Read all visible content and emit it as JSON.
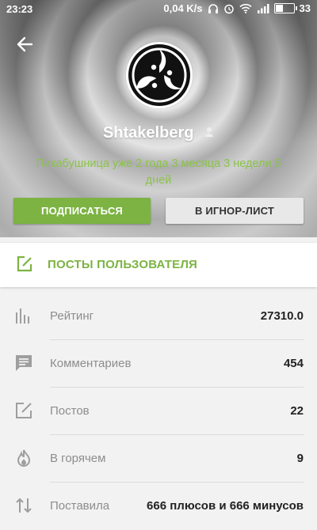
{
  "status_bar": {
    "time": "23:23",
    "speed": "0,04 K/s",
    "battery": "33"
  },
  "profile": {
    "username": "Shtakelberg",
    "tenure": "Пикабушница уже 2 года 3 месяца 3 недели 5 дней",
    "subscribe_label": "ПОДПИСАТЬСЯ",
    "ignore_label": "В ИГНОР-ЛИСТ"
  },
  "posts_link": {
    "label": "ПОСТЫ ПОЛЬЗОВАТЕЛЯ"
  },
  "stats": [
    {
      "icon": "bar-chart-icon",
      "label": "Рейтинг",
      "value": "27310.0"
    },
    {
      "icon": "comment-icon",
      "label": "Комментариев",
      "value": "454"
    },
    {
      "icon": "edit-icon",
      "label": "Постов",
      "value": "22"
    },
    {
      "icon": "flame-icon",
      "label": "В горячем",
      "value": "9"
    },
    {
      "icon": "swap-vertical-icon",
      "label": "Поставила",
      "value": "666 плюсов и 666 минусов"
    }
  ],
  "colors": {
    "accent": "#7cb342",
    "tenure_text": "#8bc34a",
    "icon_gray": "#9e9e9e"
  }
}
